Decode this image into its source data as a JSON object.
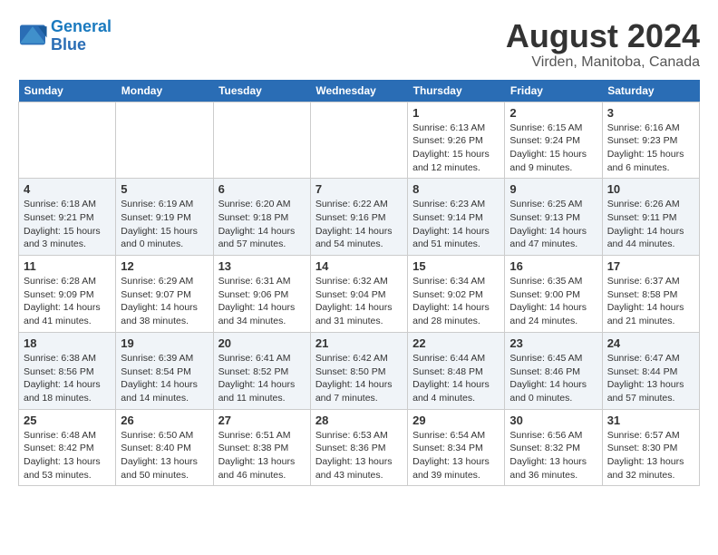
{
  "header": {
    "logo_line1": "General",
    "logo_line2": "Blue",
    "main_title": "August 2024",
    "subtitle": "Virden, Manitoba, Canada"
  },
  "days_of_week": [
    "Sunday",
    "Monday",
    "Tuesday",
    "Wednesday",
    "Thursday",
    "Friday",
    "Saturday"
  ],
  "weeks": [
    [
      {
        "day": "",
        "info": ""
      },
      {
        "day": "",
        "info": ""
      },
      {
        "day": "",
        "info": ""
      },
      {
        "day": "",
        "info": ""
      },
      {
        "day": "1",
        "info": "Sunrise: 6:13 AM\nSunset: 9:26 PM\nDaylight: 15 hours\nand 12 minutes."
      },
      {
        "day": "2",
        "info": "Sunrise: 6:15 AM\nSunset: 9:24 PM\nDaylight: 15 hours\nand 9 minutes."
      },
      {
        "day": "3",
        "info": "Sunrise: 6:16 AM\nSunset: 9:23 PM\nDaylight: 15 hours\nand 6 minutes."
      }
    ],
    [
      {
        "day": "4",
        "info": "Sunrise: 6:18 AM\nSunset: 9:21 PM\nDaylight: 15 hours\nand 3 minutes."
      },
      {
        "day": "5",
        "info": "Sunrise: 6:19 AM\nSunset: 9:19 PM\nDaylight: 15 hours\nand 0 minutes."
      },
      {
        "day": "6",
        "info": "Sunrise: 6:20 AM\nSunset: 9:18 PM\nDaylight: 14 hours\nand 57 minutes."
      },
      {
        "day": "7",
        "info": "Sunrise: 6:22 AM\nSunset: 9:16 PM\nDaylight: 14 hours\nand 54 minutes."
      },
      {
        "day": "8",
        "info": "Sunrise: 6:23 AM\nSunset: 9:14 PM\nDaylight: 14 hours\nand 51 minutes."
      },
      {
        "day": "9",
        "info": "Sunrise: 6:25 AM\nSunset: 9:13 PM\nDaylight: 14 hours\nand 47 minutes."
      },
      {
        "day": "10",
        "info": "Sunrise: 6:26 AM\nSunset: 9:11 PM\nDaylight: 14 hours\nand 44 minutes."
      }
    ],
    [
      {
        "day": "11",
        "info": "Sunrise: 6:28 AM\nSunset: 9:09 PM\nDaylight: 14 hours\nand 41 minutes."
      },
      {
        "day": "12",
        "info": "Sunrise: 6:29 AM\nSunset: 9:07 PM\nDaylight: 14 hours\nand 38 minutes."
      },
      {
        "day": "13",
        "info": "Sunrise: 6:31 AM\nSunset: 9:06 PM\nDaylight: 14 hours\nand 34 minutes."
      },
      {
        "day": "14",
        "info": "Sunrise: 6:32 AM\nSunset: 9:04 PM\nDaylight: 14 hours\nand 31 minutes."
      },
      {
        "day": "15",
        "info": "Sunrise: 6:34 AM\nSunset: 9:02 PM\nDaylight: 14 hours\nand 28 minutes."
      },
      {
        "day": "16",
        "info": "Sunrise: 6:35 AM\nSunset: 9:00 PM\nDaylight: 14 hours\nand 24 minutes."
      },
      {
        "day": "17",
        "info": "Sunrise: 6:37 AM\nSunset: 8:58 PM\nDaylight: 14 hours\nand 21 minutes."
      }
    ],
    [
      {
        "day": "18",
        "info": "Sunrise: 6:38 AM\nSunset: 8:56 PM\nDaylight: 14 hours\nand 18 minutes."
      },
      {
        "day": "19",
        "info": "Sunrise: 6:39 AM\nSunset: 8:54 PM\nDaylight: 14 hours\nand 14 minutes."
      },
      {
        "day": "20",
        "info": "Sunrise: 6:41 AM\nSunset: 8:52 PM\nDaylight: 14 hours\nand 11 minutes."
      },
      {
        "day": "21",
        "info": "Sunrise: 6:42 AM\nSunset: 8:50 PM\nDaylight: 14 hours\nand 7 minutes."
      },
      {
        "day": "22",
        "info": "Sunrise: 6:44 AM\nSunset: 8:48 PM\nDaylight: 14 hours\nand 4 minutes."
      },
      {
        "day": "23",
        "info": "Sunrise: 6:45 AM\nSunset: 8:46 PM\nDaylight: 14 hours\nand 0 minutes."
      },
      {
        "day": "24",
        "info": "Sunrise: 6:47 AM\nSunset: 8:44 PM\nDaylight: 13 hours\nand 57 minutes."
      }
    ],
    [
      {
        "day": "25",
        "info": "Sunrise: 6:48 AM\nSunset: 8:42 PM\nDaylight: 13 hours\nand 53 minutes."
      },
      {
        "day": "26",
        "info": "Sunrise: 6:50 AM\nSunset: 8:40 PM\nDaylight: 13 hours\nand 50 minutes."
      },
      {
        "day": "27",
        "info": "Sunrise: 6:51 AM\nSunset: 8:38 PM\nDaylight: 13 hours\nand 46 minutes."
      },
      {
        "day": "28",
        "info": "Sunrise: 6:53 AM\nSunset: 8:36 PM\nDaylight: 13 hours\nand 43 minutes."
      },
      {
        "day": "29",
        "info": "Sunrise: 6:54 AM\nSunset: 8:34 PM\nDaylight: 13 hours\nand 39 minutes."
      },
      {
        "day": "30",
        "info": "Sunrise: 6:56 AM\nSunset: 8:32 PM\nDaylight: 13 hours\nand 36 minutes."
      },
      {
        "day": "31",
        "info": "Sunrise: 6:57 AM\nSunset: 8:30 PM\nDaylight: 13 hours\nand 32 minutes."
      }
    ]
  ]
}
